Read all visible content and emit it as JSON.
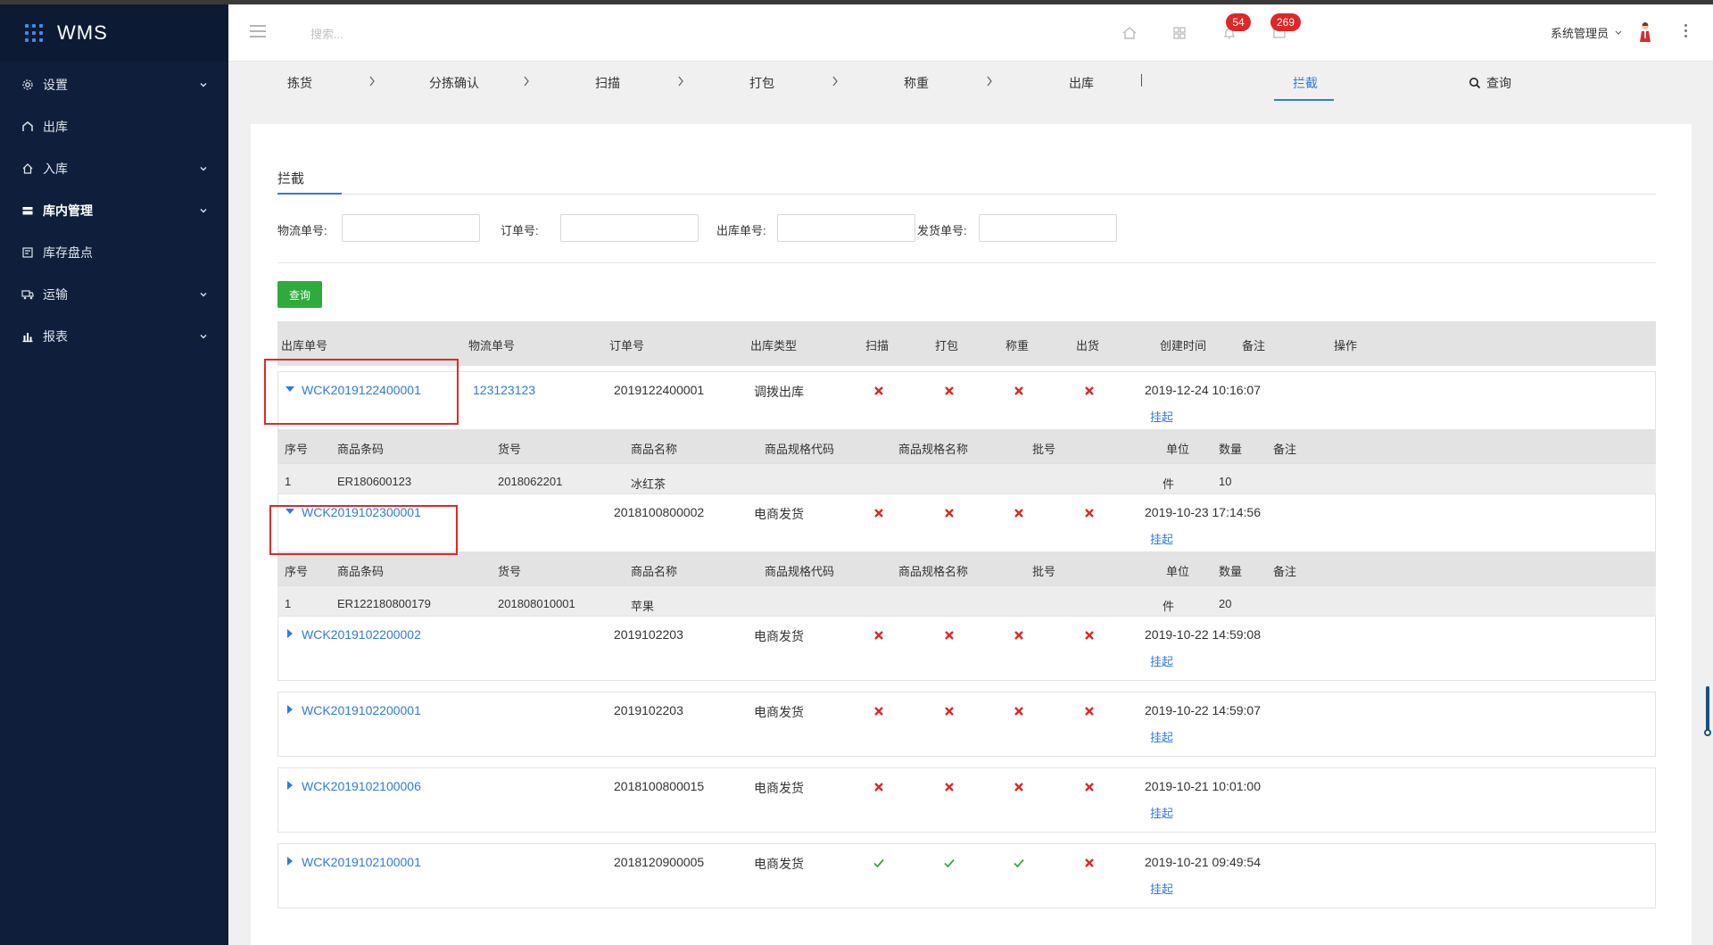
{
  "app": {
    "title": "WMS"
  },
  "sidebar": {
    "items": [
      {
        "label": "设置",
        "icon": "gear-icon",
        "has_children": true
      },
      {
        "label": "出库",
        "icon": "outbound-icon",
        "has_children": false
      },
      {
        "label": "入库",
        "icon": "inbound-icon",
        "has_children": true
      },
      {
        "label": "库内管理",
        "icon": "warehouse-icon",
        "has_children": true,
        "bold": true
      },
      {
        "label": "库存盘点",
        "icon": "inventory-icon",
        "has_children": false
      },
      {
        "label": "运输",
        "icon": "truck-icon",
        "has_children": true
      },
      {
        "label": "报表",
        "icon": "chart-icon",
        "has_children": true
      }
    ]
  },
  "header": {
    "search_placeholder": "搜索...",
    "notifications_count": "54",
    "messages_count": "269",
    "user_name": "系统管理员"
  },
  "steps": {
    "items": [
      "拣货",
      "分拣确认",
      "扫描",
      "打包",
      "称重",
      "出库"
    ],
    "active": "拦截",
    "query": "查询"
  },
  "page": {
    "tab_label": "拦截",
    "filters": {
      "logistics_label": "物流单号:",
      "order_label": "订单号:",
      "outbound_label": "出库单号:",
      "shipping_label": "发货单号:"
    },
    "query_button": "查询",
    "columns": [
      "出库单号",
      "物流单号",
      "订单号",
      "出库类型",
      "扫描",
      "打包",
      "称重",
      "出货",
      "创建时间",
      "备注",
      "操作"
    ],
    "detail_columns": [
      "序号",
      "商品条码",
      "货号",
      "商品名称",
      "商品规格代码",
      "商品规格名称",
      "批号",
      "单位",
      "数量",
      "备注"
    ],
    "action_label": "挂起",
    "orders": [
      {
        "outbound_no": "WCK2019122400001",
        "logistics_no": "123123123",
        "order_no": "2019122400001",
        "type": "调拨出库",
        "scan": "x",
        "pack": "x",
        "weigh": "x",
        "ship": "x",
        "created": "2019-12-24 10:16:07",
        "expanded": true,
        "detail": {
          "seq": "1",
          "barcode": "ER180600123",
          "sku": "2018062201",
          "name": "冰红茶",
          "unit": "件",
          "qty": "10"
        }
      },
      {
        "outbound_no": "WCK2019102300001",
        "logistics_no": "",
        "order_no": "2018100800002",
        "type": "电商发货",
        "scan": "x",
        "pack": "x",
        "weigh": "x",
        "ship": "x",
        "created": "2019-10-23 17:14:56",
        "expanded": true,
        "detail": {
          "seq": "1",
          "barcode": "ER122180800179",
          "sku": "201808010001",
          "name": "苹果",
          "unit": "件",
          "qty": "20"
        }
      },
      {
        "outbound_no": "WCK2019102200002",
        "logistics_no": "",
        "order_no": "2019102203",
        "type": "电商发货",
        "scan": "x",
        "pack": "x",
        "weigh": "x",
        "ship": "x",
        "created": "2019-10-22 14:59:08",
        "expanded": false
      },
      {
        "outbound_no": "WCK2019102200001",
        "logistics_no": "",
        "order_no": "2019102203",
        "type": "电商发货",
        "scan": "x",
        "pack": "x",
        "weigh": "x",
        "ship": "x",
        "created": "2019-10-22 14:59:07",
        "expanded": false
      },
      {
        "outbound_no": "WCK2019102100006",
        "logistics_no": "",
        "order_no": "2018100800015",
        "type": "电商发货",
        "scan": "x",
        "pack": "x",
        "weigh": "x",
        "ship": "x",
        "created": "2019-10-21 10:01:00",
        "expanded": false
      },
      {
        "outbound_no": "WCK2019102100001",
        "logistics_no": "",
        "order_no": "2018120900005",
        "type": "电商发货",
        "scan": "check",
        "pack": "check",
        "weigh": "check",
        "ship": "x",
        "created": "2019-10-21 09:49:54",
        "expanded": false
      }
    ]
  },
  "colors": {
    "sidebar_bg": "#0f1f3b",
    "accent": "#2f7ae5",
    "danger": "#e02727",
    "success": "#2eab3c",
    "highlight": "#e3272b"
  }
}
